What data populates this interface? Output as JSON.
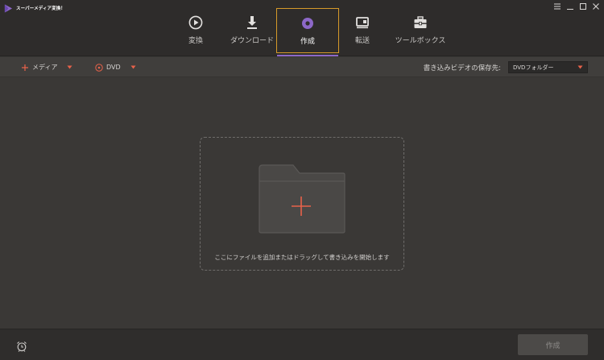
{
  "app": {
    "title": "スーパーメディア変換！",
    "logo_icon": "play-triangle-logo-icon",
    "accent_color": "#8d68c8",
    "active_border_color": "#d69a2a"
  },
  "window_controls": {
    "menu_icon": "hamburger-menu-icon",
    "minimize_icon": "minimize-icon",
    "maximize_icon": "maximize-icon",
    "close_icon": "close-icon"
  },
  "nav": {
    "items": [
      {
        "label": "変換",
        "icon": "convert-icon",
        "active": false
      },
      {
        "label": "ダウンロード",
        "icon": "download-icon",
        "active": false
      },
      {
        "label": "作成",
        "icon": "burn-disc-icon",
        "active": true
      },
      {
        "label": "転送",
        "icon": "transfer-icon",
        "active": false
      },
      {
        "label": "ツールボックス",
        "icon": "toolbox-icon",
        "active": false
      }
    ]
  },
  "toolbar": {
    "add_media_label": "メディア",
    "add_media_icon": "plus-icon",
    "add_dvd_label": "DVD",
    "add_dvd_icon": "disc-icon",
    "dropdown_icon": "caret-down-icon",
    "destination_label": "書き込みビデオの保存先:",
    "destination_value": "DVDフォルダー"
  },
  "dropzone": {
    "hint": "ここにファイルを追加またはドラッグして書き込みを開始します",
    "icon": "folder-add-icon"
  },
  "bottombar": {
    "alarm_icon": "alarm-clock-icon",
    "create_button_label": "作成"
  }
}
